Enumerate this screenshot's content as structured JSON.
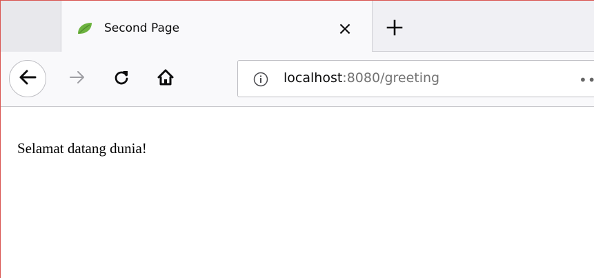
{
  "tab": {
    "title": "Second Page",
    "close_symbol": "×",
    "favicon": "spring-leaf-icon"
  },
  "toolbar": {
    "url_host": "localhost",
    "url_rest": ":8080/greeting",
    "page_actions": "••",
    "icons": [
      "back-arrow-icon",
      "forward-arrow-icon",
      "reload-icon",
      "home-icon",
      "info-icon",
      "plus-icon"
    ]
  },
  "page": {
    "text": "Selamat datang dunia!"
  },
  "colors": {
    "favicon": "#6db33f",
    "window_border": "#d9534f",
    "url_secondary": "#737373"
  }
}
